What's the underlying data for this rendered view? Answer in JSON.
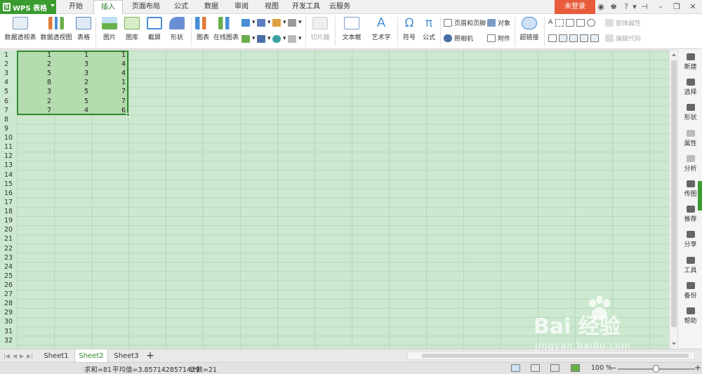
{
  "app": {
    "name": "WPS 表格",
    "logo": "S"
  },
  "tabs": [
    {
      "label": "开始"
    },
    {
      "label": "插入"
    },
    {
      "label": "页面布局"
    },
    {
      "label": "公式"
    },
    {
      "label": "数据"
    },
    {
      "label": "审阅"
    },
    {
      "label": "视图"
    },
    {
      "label": "开发工具"
    },
    {
      "label": "云服务"
    }
  ],
  "active_tab": "插入",
  "login_label": "未登录",
  "ribbon": {
    "pivot_table": "数据透视表",
    "pivot_chart": "数据透视图",
    "table": "表格",
    "picture": "图片",
    "gallery": "图库",
    "screenshot": "截屏",
    "shape": "形状",
    "chart": "图表",
    "online_chart": "在线图表",
    "slicer": "切片器",
    "textbox": "文本框",
    "wordart": "艺术字",
    "symbol": "符号",
    "formula": "公式",
    "header_footer": "页眉和页脚",
    "object": "对象",
    "camera": "照相机",
    "attachment": "附件",
    "hyperlink": "超链接",
    "form_props": "窗体属性",
    "edit_code": "编辑代码"
  },
  "row_numbers": [
    "1",
    "2",
    "3",
    "4",
    "5",
    "6",
    "7",
    "8",
    "9",
    "10",
    "11",
    "12",
    "13",
    "14",
    "15",
    "16",
    "17",
    "18",
    "19",
    "20",
    "21",
    "22",
    "23",
    "24",
    "25",
    "26",
    "27",
    "28",
    "29",
    "30",
    "31",
    "32"
  ],
  "cells": [
    [
      "1",
      "1",
      "1"
    ],
    [
      "2",
      "3",
      "4"
    ],
    [
      "5",
      "3",
      "4"
    ],
    [
      "8",
      "2",
      "1"
    ],
    [
      "3",
      "5",
      "7"
    ],
    [
      "2",
      "5",
      "7"
    ],
    [
      "7",
      "4",
      "6"
    ]
  ],
  "side_panel": [
    {
      "label": "新建",
      "icon": "new-icon",
      "enabled": true
    },
    {
      "label": "选择",
      "icon": "select-icon",
      "enabled": true
    },
    {
      "label": "形状",
      "icon": "shape-icon",
      "enabled": true
    },
    {
      "label": "属性",
      "icon": "properties-icon",
      "enabled": false
    },
    {
      "label": "分析",
      "icon": "analysis-icon",
      "enabled": false
    },
    {
      "label": "传图",
      "icon": "upload-image-icon",
      "enabled": true
    },
    {
      "label": "推荐",
      "icon": "recommend-icon",
      "enabled": true
    },
    {
      "label": "分享",
      "icon": "share-icon",
      "enabled": true
    },
    {
      "label": "工具",
      "icon": "toolbox-icon",
      "enabled": true
    },
    {
      "label": "备份",
      "icon": "backup-icon",
      "enabled": true
    },
    {
      "label": "帮助",
      "icon": "help-icon",
      "enabled": true
    }
  ],
  "sheets": [
    "Sheet1",
    "Sheet2",
    "Sheet3"
  ],
  "active_sheet": "Sheet2",
  "status": {
    "sum": "求和=81",
    "average": "平均值=3.8571428571429",
    "count": "计数=21",
    "zoom": "100 %"
  },
  "watermark": {
    "brand": "Bai 经验",
    "url": "jingyan.baidu.com"
  },
  "colors": {
    "accent": "#3a9b2f",
    "login": "#e85c3c",
    "grid_bg": "#cce8cf",
    "selection": "#b4dcae"
  }
}
